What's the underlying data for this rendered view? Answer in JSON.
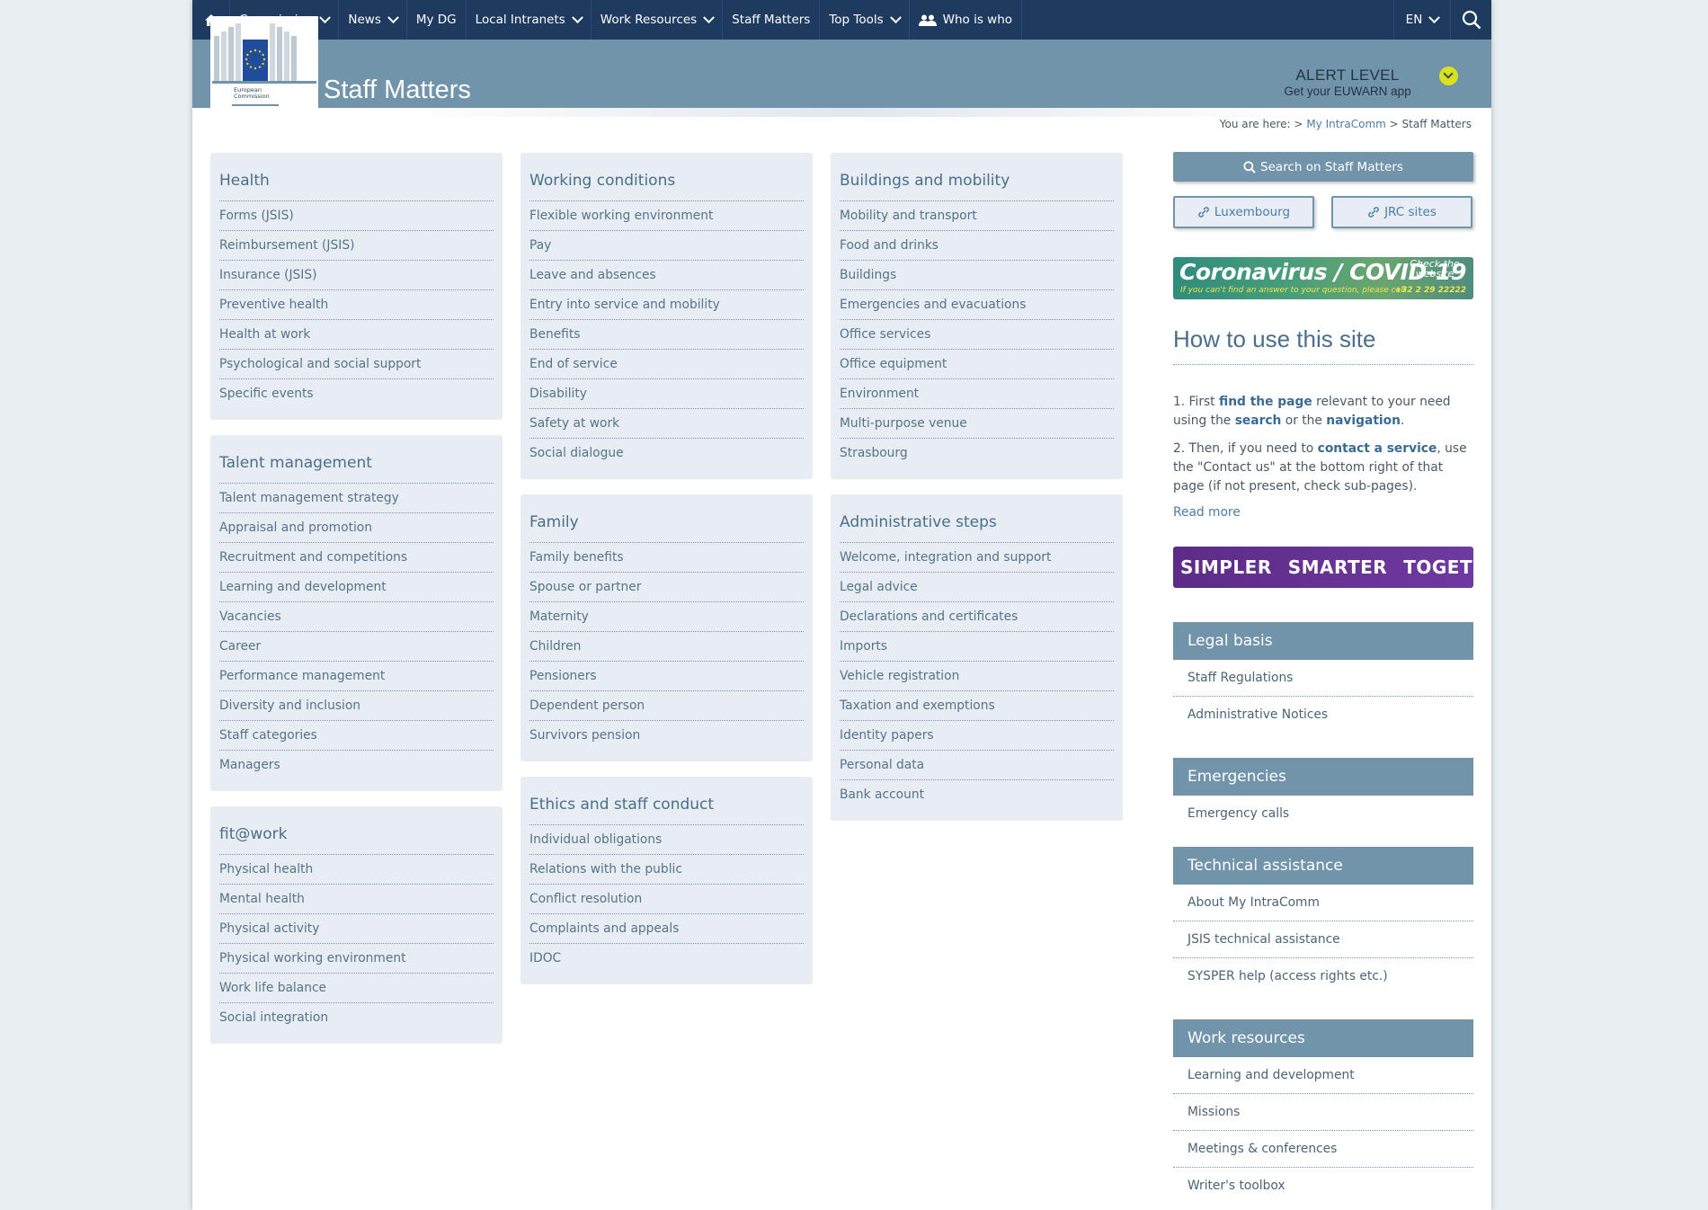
{
  "nav": {
    "items": [
      {
        "label": "Commission",
        "dropdown": true
      },
      {
        "label": "News",
        "dropdown": true
      },
      {
        "label": "My DG",
        "dropdown": false
      },
      {
        "label": "Local Intranets",
        "dropdown": true
      },
      {
        "label": "Work Resources",
        "dropdown": true
      },
      {
        "label": "Staff Matters",
        "dropdown": false
      },
      {
        "label": "Top Tools",
        "dropdown": true
      },
      {
        "label": "Who is who",
        "dropdown": false
      }
    ],
    "language": "EN",
    "icons": {
      "home": "home-icon",
      "people": "people-icon",
      "search": "search-icon"
    }
  },
  "header": {
    "site_title": "Staff Matters",
    "logo_text_1": "European",
    "logo_text_2": "Commission",
    "alert_title": "ALERT LEVEL",
    "alert_sub": "Get your EUWARN app",
    "alert_color": "#d9e21c"
  },
  "breadcrumb": {
    "prefix": "You are here:",
    "links": [
      "My IntraComm"
    ],
    "current": "Staff Matters"
  },
  "categories": {
    "health": {
      "title": "Health",
      "items": [
        "Forms (JSIS)",
        "Reimbursement (JSIS)",
        "Insurance (JSIS)",
        "Preventive health",
        "Health at work",
        "Psychological and social support",
        "Specific events"
      ]
    },
    "talent": {
      "title": "Talent management",
      "items": [
        "Talent management strategy",
        "Appraisal and promotion",
        "Recruitment and competitions",
        "Learning and development",
        "Vacancies",
        "Career",
        "Performance management",
        "Diversity and inclusion",
        "Staff categories",
        "Managers"
      ]
    },
    "fitwork": {
      "title": "fit@work",
      "items": [
        "Physical health",
        "Mental health",
        "Physical activity",
        "Physical working environment",
        "Work life balance",
        "Social integration"
      ]
    },
    "working": {
      "title": "Working conditions",
      "items": [
        "Flexible working environment",
        "Pay",
        "Leave and absences",
        "Entry into service and mobility",
        "Benefits",
        "End of service",
        "Disability",
        "Safety at work",
        "Social dialogue"
      ]
    },
    "family": {
      "title": "Family",
      "items": [
        "Family benefits",
        "Spouse or partner",
        "Maternity",
        "Children",
        "Pensioners",
        "Dependent person",
        "Survivors pension"
      ]
    },
    "ethics": {
      "title": "Ethics and staff conduct",
      "items": [
        "Individual obligations",
        "Relations with the public",
        "Conflict resolution",
        "Complaints and appeals",
        "IDOC"
      ]
    },
    "buildings": {
      "title": "Buildings and mobility",
      "items": [
        "Mobility and transport",
        "Food and drinks",
        "Buildings",
        "Emergencies and evacuations",
        "Office services",
        "Office equipment",
        "Environment",
        "Multi-purpose venue",
        "Strasbourg"
      ]
    },
    "admin": {
      "title": "Administrative steps",
      "items": [
        "Welcome, integration and support",
        "Legal advice",
        "Declarations and certificates",
        "Imports",
        "Vehicle registration",
        "Taxation and exemptions",
        "Identity papers",
        "Personal data",
        "Bank account"
      ]
    }
  },
  "sidebar": {
    "search_label": "Search on Staff Matters",
    "link_buttons": [
      "Luxembourg",
      "JRC sites"
    ],
    "covid": {
      "title": "Coronavirus / COVID-19",
      "cta": "Check the website",
      "sub": "If you can't find an answer to your question, please call",
      "phone": "+32 2 29 22222"
    },
    "howto": {
      "title": "How to use this site",
      "p1_a": "1. First ",
      "p1_b": "find the page",
      "p1_c": " relevant to your need using the ",
      "p1_d": "search",
      "p1_e": " or the ",
      "p1_f": "navigation",
      "p1_g": ".",
      "p2_a": "2. Then, if you need to ",
      "p2_b": "contact a service",
      "p2_c": ", use the \"Contact us\" at the bottom right of that page (if not present, check sub-pages).",
      "read_more": "Read more"
    },
    "banner": [
      "SIMPLER",
      "SMARTER",
      "TOGETHER"
    ],
    "sections": {
      "legal": {
        "title": "Legal basis",
        "links": [
          "Staff Regulations",
          "Administrative Notices"
        ]
      },
      "emergencies": {
        "title": "Emergencies",
        "links": [
          "Emergency calls"
        ]
      },
      "technical": {
        "title": "Technical assistance",
        "links": [
          "About My IntraComm",
          "JSIS technical assistance",
          "SYSPER help (access rights etc.)"
        ]
      },
      "work": {
        "title": "Work resources",
        "links": [
          "Learning and development",
          "Missions",
          "Meetings & conferences",
          "Writer's toolbox"
        ]
      }
    }
  }
}
